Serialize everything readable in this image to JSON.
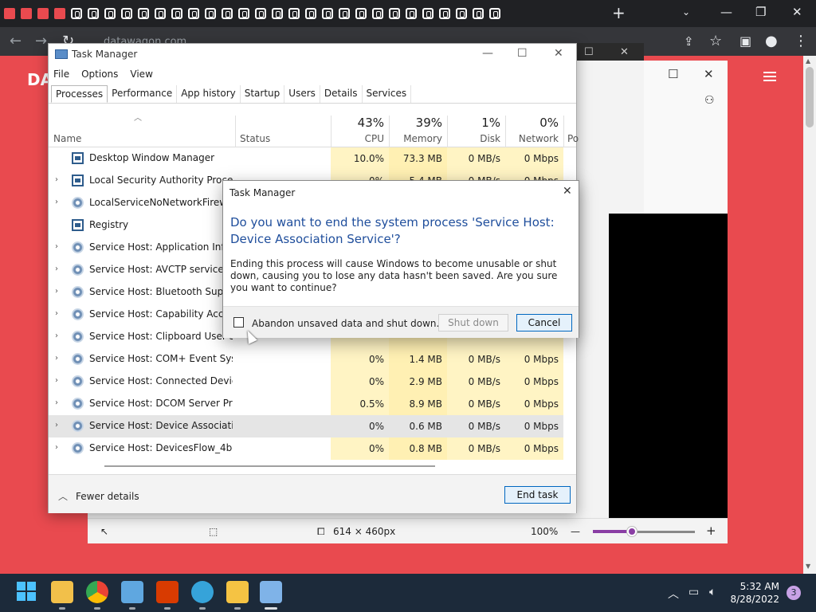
{
  "browser": {
    "url": "datawagon.com",
    "new_tab": "+",
    "min": "—",
    "restore": "❐",
    "close": "✕"
  },
  "page": {
    "logo": "DA"
  },
  "snip": {
    "dimensions": "614 × 460px",
    "zoom": "100%",
    "zoom_level": 0.38
  },
  "task_manager": {
    "title": "Task Manager",
    "menu": [
      "File",
      "Options",
      "View"
    ],
    "tabs": [
      "Processes",
      "Performance",
      "App history",
      "Startup",
      "Users",
      "Details",
      "Services"
    ],
    "columns": {
      "name": "Name",
      "status": "Status",
      "cpu_pct": "43%",
      "cpu": "CPU",
      "mem_pct": "39%",
      "mem": "Memory",
      "disk_pct": "1%",
      "disk": "Disk",
      "net_pct": "0%",
      "net": "Network",
      "power_trunc": "Po"
    },
    "rows": [
      {
        "name": "Desktop Window Manager",
        "cpu": "10.0%",
        "mem": "73.3 MB",
        "disk": "0 MB/s",
        "net": "0 Mbps",
        "expand": false,
        "icon": "window"
      },
      {
        "name": "Local Security Authority Process...",
        "cpu": "0%",
        "mem": "5.4 MB",
        "disk": "0 MB/s",
        "net": "0 Mbps",
        "expand": true,
        "icon": "window"
      },
      {
        "name": "LocalServiceNoNetworkFirewall",
        "cpu": "",
        "mem": "",
        "disk": "",
        "net": "",
        "expand": true,
        "icon": "gear"
      },
      {
        "name": "Registry",
        "cpu": "",
        "mem": "",
        "disk": "",
        "net": "",
        "expand": false,
        "icon": "window"
      },
      {
        "name": "Service Host: Application Infor...",
        "cpu": "",
        "mem": "",
        "disk": "",
        "net": "",
        "expand": true,
        "icon": "gear"
      },
      {
        "name": "Service Host: AVCTP service",
        "cpu": "",
        "mem": "",
        "disk": "",
        "net": "",
        "expand": true,
        "icon": "gear"
      },
      {
        "name": "Service Host: Bluetooth Support",
        "cpu": "",
        "mem": "",
        "disk": "",
        "net": "",
        "expand": true,
        "icon": "gear"
      },
      {
        "name": "Service Host: Capability Access",
        "cpu": "",
        "mem": "",
        "disk": "",
        "net": "",
        "expand": true,
        "icon": "gear"
      },
      {
        "name": "Service Host: Clipboard User Ser",
        "cpu": "",
        "mem": "",
        "disk": "",
        "net": "",
        "expand": true,
        "icon": "gear"
      },
      {
        "name": "Service Host: COM+ Event Syste...",
        "cpu": "0%",
        "mem": "1.4 MB",
        "disk": "0 MB/s",
        "net": "0 Mbps",
        "expand": true,
        "icon": "gear"
      },
      {
        "name": "Service Host: Connected Device...",
        "cpu": "0%",
        "mem": "2.9 MB",
        "disk": "0 MB/s",
        "net": "0 Mbps",
        "expand": true,
        "icon": "gear"
      },
      {
        "name": "Service Host: DCOM Server Proc...",
        "cpu": "0.5%",
        "mem": "8.9 MB",
        "disk": "0 MB/s",
        "net": "0 Mbps",
        "expand": true,
        "icon": "gear"
      },
      {
        "name": "Service Host: Device Associatio...",
        "cpu": "0%",
        "mem": "0.6 MB",
        "disk": "0 MB/s",
        "net": "0 Mbps",
        "expand": true,
        "icon": "gear",
        "selected": true
      },
      {
        "name": "Service Host: DevicesFlow_4bd45",
        "cpu": "0%",
        "mem": "0.8 MB",
        "disk": "0 MB/s",
        "net": "0 Mbps",
        "expand": true,
        "icon": "gear"
      }
    ],
    "fewer_details": "Fewer details",
    "end_task": "End task"
  },
  "dialog": {
    "title": "Task Manager",
    "question": "Do you want to end the system process 'Service Host: Device Association Service'?",
    "body": "Ending this process will cause Windows to become unusable or shut down, causing you to lose any data hasn't been saved. Are you sure you want to continue?",
    "checkbox_label": "Abandon unsaved data and shut down.",
    "shutdown": "Shut down",
    "cancel": "Cancel"
  },
  "taskbar": {
    "time": "5:32 AM",
    "date": "8/28/2022",
    "notifications": "3"
  }
}
